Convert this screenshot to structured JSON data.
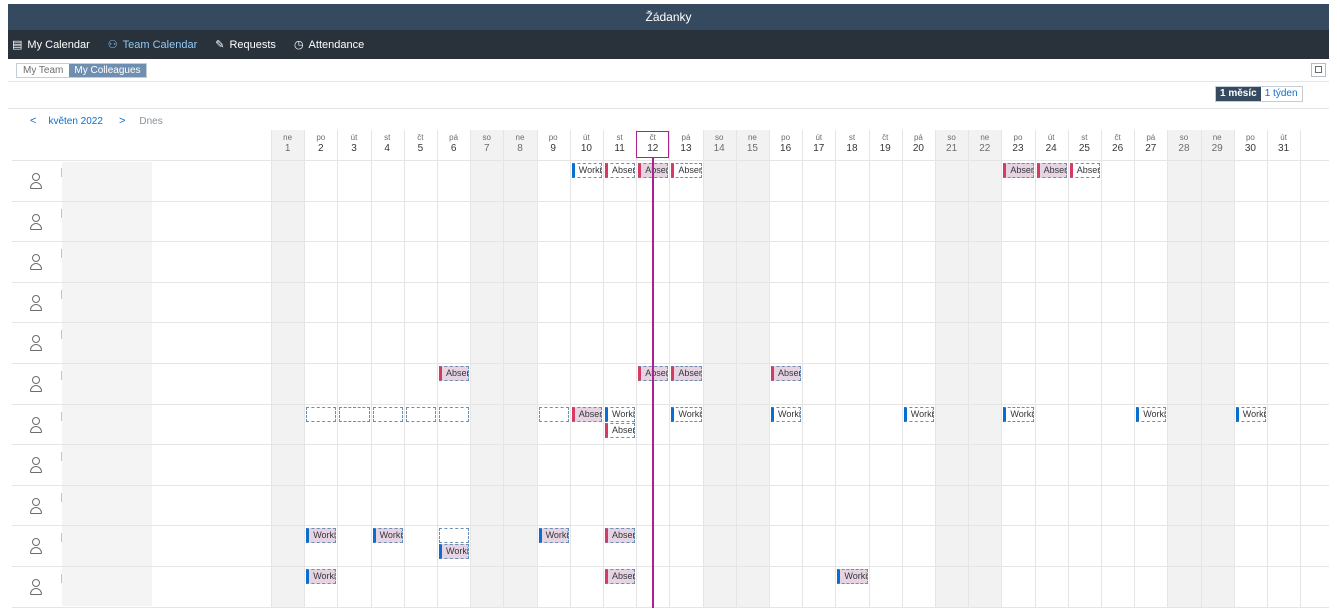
{
  "app": {
    "title": "Žádanky"
  },
  "nav": [
    {
      "label": "My Calendar",
      "icon": "calendar-icon",
      "glyph": "▤",
      "active": false
    },
    {
      "label": "Team Calendar",
      "icon": "team-icon",
      "glyph": "⚇",
      "active": true
    },
    {
      "label": "Requests",
      "icon": "request-icon",
      "glyph": "✎",
      "active": false
    },
    {
      "label": "Attendance",
      "icon": "attendance-icon",
      "glyph": "◷",
      "active": false
    }
  ],
  "team_toggle": {
    "my_team": "My Team",
    "my_colleagues": "My Colleagues"
  },
  "view_toggle": {
    "month": "1 měsíc",
    "week": "1 týden"
  },
  "month_nav": {
    "prev": "<",
    "label": "květen 2022",
    "next": ">",
    "today": "Dnes"
  },
  "days": [
    {
      "dow": "ne",
      "num": "1",
      "weekend": true
    },
    {
      "dow": "po",
      "num": "2",
      "weekend": false
    },
    {
      "dow": "út",
      "num": "3",
      "weekend": false
    },
    {
      "dow": "st",
      "num": "4",
      "weekend": false
    },
    {
      "dow": "čt",
      "num": "5",
      "weekend": false
    },
    {
      "dow": "pá",
      "num": "6",
      "weekend": false
    },
    {
      "dow": "so",
      "num": "7",
      "weekend": true
    },
    {
      "dow": "ne",
      "num": "8",
      "weekend": true
    },
    {
      "dow": "po",
      "num": "9",
      "weekend": false
    },
    {
      "dow": "út",
      "num": "10",
      "weekend": false
    },
    {
      "dow": "st",
      "num": "11",
      "weekend": false
    },
    {
      "dow": "čt",
      "num": "12",
      "weekend": false
    },
    {
      "dow": "pá",
      "num": "13",
      "weekend": false
    },
    {
      "dow": "so",
      "num": "14",
      "weekend": true
    },
    {
      "dow": "ne",
      "num": "15",
      "weekend": true
    },
    {
      "dow": "po",
      "num": "16",
      "weekend": false
    },
    {
      "dow": "út",
      "num": "17",
      "weekend": false
    },
    {
      "dow": "st",
      "num": "18",
      "weekend": false
    },
    {
      "dow": "čt",
      "num": "19",
      "weekend": false
    },
    {
      "dow": "pá",
      "num": "20",
      "weekend": false
    },
    {
      "dow": "so",
      "num": "21",
      "weekend": true
    },
    {
      "dow": "ne",
      "num": "22",
      "weekend": true
    },
    {
      "dow": "po",
      "num": "23",
      "weekend": false
    },
    {
      "dow": "út",
      "num": "24",
      "weekend": false
    },
    {
      "dow": "st",
      "num": "25",
      "weekend": false
    },
    {
      "dow": "čt",
      "num": "26",
      "weekend": false
    },
    {
      "dow": "pá",
      "num": "27",
      "weekend": false
    },
    {
      "dow": "so",
      "num": "28",
      "weekend": true
    },
    {
      "dow": "ne",
      "num": "29",
      "weekend": true
    },
    {
      "dow": "po",
      "num": "30",
      "weekend": false
    },
    {
      "dow": "út",
      "num": "31",
      "weekend": false
    }
  ],
  "today_day": 12,
  "row_count": 11,
  "events": [
    {
      "row": 0,
      "day": 10,
      "label": "Worki",
      "kind": "work",
      "fill": "white",
      "sub": 0
    },
    {
      "row": 0,
      "day": 11,
      "label": "Abser",
      "kind": "abs",
      "fill": "white",
      "sub": 0
    },
    {
      "row": 0,
      "day": 12,
      "label": "Abser",
      "kind": "abs",
      "fill": "pink",
      "sub": 0
    },
    {
      "row": 0,
      "day": 13,
      "label": "Abser",
      "kind": "abs",
      "fill": "white",
      "sub": 0
    },
    {
      "row": 0,
      "day": 23,
      "label": "Abser",
      "kind": "abs",
      "fill": "pink",
      "sub": 0
    },
    {
      "row": 0,
      "day": 24,
      "label": "Abser",
      "kind": "abs",
      "fill": "pink",
      "sub": 0
    },
    {
      "row": 0,
      "day": 25,
      "label": "Abser",
      "kind": "abs",
      "fill": "white",
      "sub": 0
    },
    {
      "row": 5,
      "day": 6,
      "label": "Abser",
      "kind": "abs",
      "fill": "pink",
      "sub": 0
    },
    {
      "row": 5,
      "day": 12,
      "label": "Abser",
      "kind": "abs",
      "fill": "pink",
      "sub": 0
    },
    {
      "row": 5,
      "day": 13,
      "label": "Abser",
      "kind": "abs",
      "fill": "pink",
      "sub": 0
    },
    {
      "row": 5,
      "day": 16,
      "label": "Abser",
      "kind": "abs",
      "fill": "pink",
      "sub": 0
    },
    {
      "row": 6,
      "day": 2,
      "label": "",
      "kind": "empty",
      "fill": "white",
      "sub": 0
    },
    {
      "row": 6,
      "day": 3,
      "label": "",
      "kind": "empty",
      "fill": "white",
      "sub": 0
    },
    {
      "row": 6,
      "day": 4,
      "label": "",
      "kind": "empty",
      "fill": "white",
      "sub": 0
    },
    {
      "row": 6,
      "day": 5,
      "label": "",
      "kind": "empty",
      "fill": "white",
      "sub": 0
    },
    {
      "row": 6,
      "day": 6,
      "label": "",
      "kind": "empty",
      "fill": "white",
      "sub": 0
    },
    {
      "row": 6,
      "day": 9,
      "label": "",
      "kind": "empty",
      "fill": "white",
      "sub": 0
    },
    {
      "row": 6,
      "day": 10,
      "label": "Abser",
      "kind": "abs",
      "fill": "pink",
      "sub": 0
    },
    {
      "row": 6,
      "day": 11,
      "label": "Worki",
      "kind": "work",
      "fill": "white",
      "sub": 0
    },
    {
      "row": 6,
      "day": 11,
      "label": "Abser",
      "kind": "abs",
      "fill": "white",
      "sub": 1
    },
    {
      "row": 6,
      "day": 13,
      "label": "Worki",
      "kind": "work",
      "fill": "white",
      "sub": 0
    },
    {
      "row": 6,
      "day": 16,
      "label": "Worki",
      "kind": "work",
      "fill": "white",
      "sub": 0
    },
    {
      "row": 6,
      "day": 20,
      "label": "Worki",
      "kind": "work",
      "fill": "white",
      "sub": 0
    },
    {
      "row": 6,
      "day": 23,
      "label": "Worki",
      "kind": "work",
      "fill": "white",
      "sub": 0
    },
    {
      "row": 6,
      "day": 27,
      "label": "Worki",
      "kind": "work",
      "fill": "white",
      "sub": 0
    },
    {
      "row": 6,
      "day": 30,
      "label": "Worki",
      "kind": "work",
      "fill": "white",
      "sub": 0
    },
    {
      "row": 9,
      "day": 2,
      "label": "Worki",
      "kind": "work",
      "fill": "pink",
      "sub": 0
    },
    {
      "row": 9,
      "day": 4,
      "label": "Worki",
      "kind": "work",
      "fill": "pink",
      "sub": 0
    },
    {
      "row": 9,
      "day": 6,
      "label": "",
      "kind": "empty",
      "fill": "white",
      "sub": 0
    },
    {
      "row": 9,
      "day": 6,
      "label": "Worki",
      "kind": "work",
      "fill": "pink",
      "sub": 1
    },
    {
      "row": 9,
      "day": 9,
      "label": "Worki",
      "kind": "work",
      "fill": "pink",
      "sub": 0
    },
    {
      "row": 9,
      "day": 11,
      "label": "Abser",
      "kind": "abs",
      "fill": "pink",
      "sub": 0
    },
    {
      "row": 10,
      "day": 2,
      "label": "Worki",
      "kind": "work",
      "fill": "pink",
      "sub": 0
    },
    {
      "row": 10,
      "day": 11,
      "label": "Abser",
      "kind": "abs",
      "fill": "pink",
      "sub": 0
    },
    {
      "row": 10,
      "day": 18,
      "label": "Worki",
      "kind": "work",
      "fill": "pink",
      "sub": 0
    }
  ]
}
